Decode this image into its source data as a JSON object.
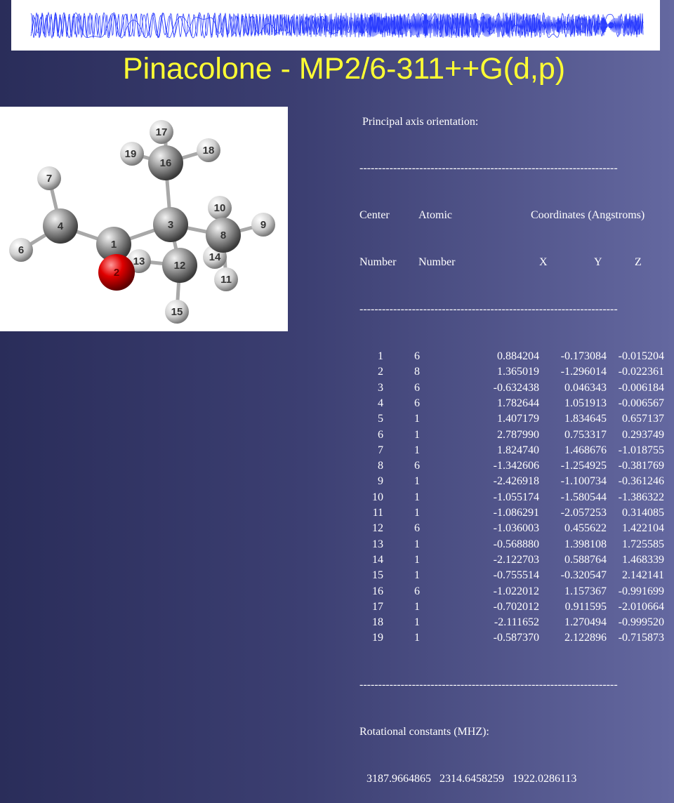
{
  "title": "Pinacolone - MP2/6-311++G(d,p)",
  "colors": {
    "title": "#ffff33",
    "text": "#ffffff",
    "oxygen": "#dd0000",
    "carbon": "#8a8a8a",
    "hydrogen": "#e0e0e0",
    "banner_wave": "#2a3cff"
  },
  "molecule": {
    "atoms": [
      {
        "label": "1",
        "element": "C"
      },
      {
        "label": "2",
        "element": "O"
      },
      {
        "label": "3",
        "element": "C"
      },
      {
        "label": "4",
        "element": "C"
      },
      {
        "label": "6",
        "element": "H"
      },
      {
        "label": "7",
        "element": "H"
      },
      {
        "label": "8",
        "element": "C"
      },
      {
        "label": "9",
        "element": "H"
      },
      {
        "label": "10",
        "element": "H"
      },
      {
        "label": "11",
        "element": "H"
      },
      {
        "label": "12",
        "element": "C"
      },
      {
        "label": "13",
        "element": "H"
      },
      {
        "label": "14",
        "element": "H"
      },
      {
        "label": "15",
        "element": "H"
      },
      {
        "label": "16",
        "element": "C"
      },
      {
        "label": "17",
        "element": "H"
      },
      {
        "label": "18",
        "element": "H"
      },
      {
        "label": "19",
        "element": "H"
      }
    ]
  },
  "output": {
    "heading": "Principal axis orientation:",
    "separator": "---------------------------------------------------------------------",
    "header1": {
      "center": "Center",
      "atomic": "Atomic",
      "coords": "Coordinates (Angstroms)"
    },
    "header2": {
      "number1": "Number",
      "number2": "Number",
      "x": "X",
      "y": "Y",
      "z": "Z"
    },
    "rows": [
      {
        "center": "1",
        "atomic": "6",
        "x": "0.884204",
        "y": "-0.173084",
        "z": "-0.015204"
      },
      {
        "center": "2",
        "atomic": "8",
        "x": "1.365019",
        "y": "-1.296014",
        "z": "-0.022361"
      },
      {
        "center": "3",
        "atomic": "6",
        "x": "-0.632438",
        "y": "0.046343",
        "z": "-0.006184"
      },
      {
        "center": "4",
        "atomic": "6",
        "x": "1.782644",
        "y": "1.051913",
        "z": "-0.006567"
      },
      {
        "center": "5",
        "atomic": "1",
        "x": "1.407179",
        "y": "1.834645",
        "z": "0.657137"
      },
      {
        "center": "6",
        "atomic": "1",
        "x": "2.787990",
        "y": "0.753317",
        "z": "0.293749"
      },
      {
        "center": "7",
        "atomic": "1",
        "x": "1.824740",
        "y": "1.468676",
        "z": "-1.018755"
      },
      {
        "center": "8",
        "atomic": "6",
        "x": "-1.342606",
        "y": "-1.254925",
        "z": "-0.381769"
      },
      {
        "center": "9",
        "atomic": "1",
        "x": "-2.426918",
        "y": "-1.100734",
        "z": "-0.361246"
      },
      {
        "center": "10",
        "atomic": "1",
        "x": "-1.055174",
        "y": "-1.580544",
        "z": "-1.386322"
      },
      {
        "center": "11",
        "atomic": "1",
        "x": "-1.086291",
        "y": "-2.057253",
        "z": "0.314085"
      },
      {
        "center": "12",
        "atomic": "6",
        "x": "-1.036003",
        "y": "0.455622",
        "z": "1.422104"
      },
      {
        "center": "13",
        "atomic": "1",
        "x": "-0.568880",
        "y": "1.398108",
        "z": "1.725585"
      },
      {
        "center": "14",
        "atomic": "1",
        "x": "-2.122703",
        "y": "0.588764",
        "z": "1.468339"
      },
      {
        "center": "15",
        "atomic": "1",
        "x": "-0.755514",
        "y": "-0.320547",
        "z": "2.142141"
      },
      {
        "center": "16",
        "atomic": "6",
        "x": "-1.022012",
        "y": "1.157367",
        "z": "-0.991699"
      },
      {
        "center": "17",
        "atomic": "1",
        "x": "-0.702012",
        "y": "0.911595",
        "z": "-2.010664"
      },
      {
        "center": "18",
        "atomic": "1",
        "x": "-2.111652",
        "y": "1.270494",
        "z": "-0.999520"
      },
      {
        "center": "19",
        "atomic": "1",
        "x": "-0.587370",
        "y": "2.122896",
        "z": "-0.715873"
      }
    ],
    "rot_label": "Rotational constants (MHZ):",
    "rot_values": "3187.9664865   2314.6458259   1922.0286113"
  }
}
